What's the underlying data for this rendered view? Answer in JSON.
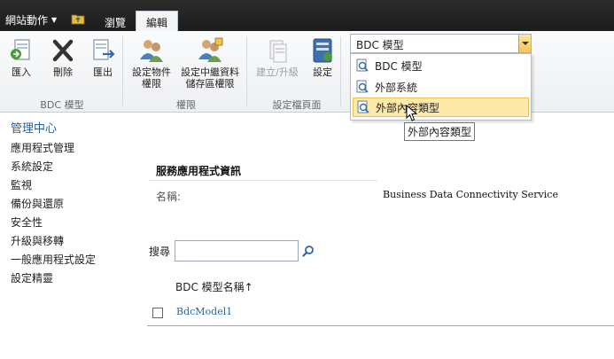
{
  "topbar": {
    "site_actions": "網站動作",
    "tab_browse": "瀏覽",
    "tab_edit": "編輯"
  },
  "ribbon": {
    "import_label": "匯入",
    "delete_label": "刪除",
    "export_label": "匯出",
    "group_bdc": "BDC 模型",
    "set_object_perm": [
      "設定物件",
      "權限"
    ],
    "set_metadata_perm": [
      "設定中繼資料",
      "儲存區權限"
    ],
    "group_perm": "權限",
    "create_upgrade_label": "建立/升級",
    "settings_label": "設定",
    "group_profile": "設定檔頁面"
  },
  "view_dropdown": {
    "selected": "BDC 模型",
    "options": [
      "BDC 模型",
      "外部系統",
      "外部內容類型"
    ],
    "hovered_index": 2,
    "tooltip": "外部內容類型"
  },
  "left_nav": {
    "heading": "管理中心",
    "items": [
      "應用程式管理",
      "系統設定",
      "監視",
      "備份與還原",
      "安全性",
      "升級與移轉",
      "一般應用程式設定",
      "設定精靈"
    ]
  },
  "main": {
    "section_title": "服務應用程式資訊",
    "name_label": "名稱:",
    "name_value": "Business Data Connectivity Service",
    "search_label": "搜尋",
    "search_value": "",
    "column_header": "BDC 模型名稱↑",
    "rows": [
      {
        "name": "BdcModel1",
        "checked": false
      }
    ]
  },
  "colors": {
    "topbar_bg": "#1c1c1c",
    "nav_heading": "#1f5fa8",
    "link": "#2765a4",
    "hover_bg": "#fde9a9"
  }
}
